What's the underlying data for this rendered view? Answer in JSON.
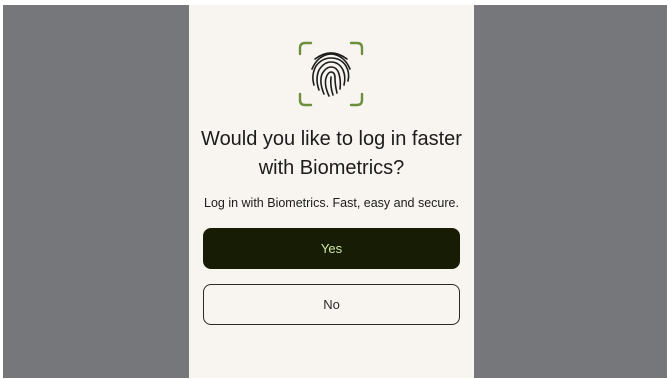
{
  "dialog": {
    "icon": "fingerprint-icon",
    "title_line1": "Would you like to log in faster",
    "title_line2": "with Biometrics?",
    "subtitle": "Log in with Biometrics. Fast, easy and secure.",
    "yes_label": "Yes",
    "no_label": "No"
  },
  "colors": {
    "backdrop": "#76777b",
    "sheet": "#f8f4f0",
    "accent_green": "#6b8f3c",
    "yes_button_bg": "#171d05",
    "yes_button_text": "#cfe6a4"
  }
}
